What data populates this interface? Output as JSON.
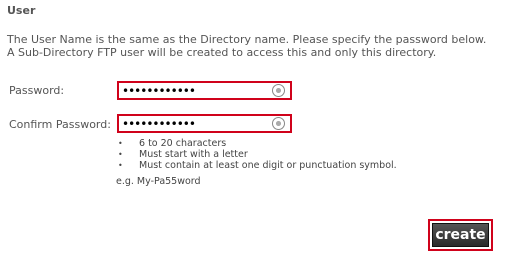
{
  "section_title": "User",
  "description": {
    "line1": "The User Name is the same as the Directory name. Please specify the password below.",
    "line2": "A Sub-Directory FTP user will be created to access this and only this directory."
  },
  "password": {
    "label": "Password:",
    "value": "••••••••••••"
  },
  "confirm_password": {
    "label": "Confirm Password:",
    "value": "••••••••••••"
  },
  "rules": [
    "6 to 20 characters",
    "Must start with a letter",
    "Must contain at least one digit or punctuation symbol."
  ],
  "example": "e.g. My-Pa55word",
  "create_button_label": "create",
  "colors": {
    "highlight_border": "#d0021b",
    "button_bg": "#3a3a3a"
  }
}
